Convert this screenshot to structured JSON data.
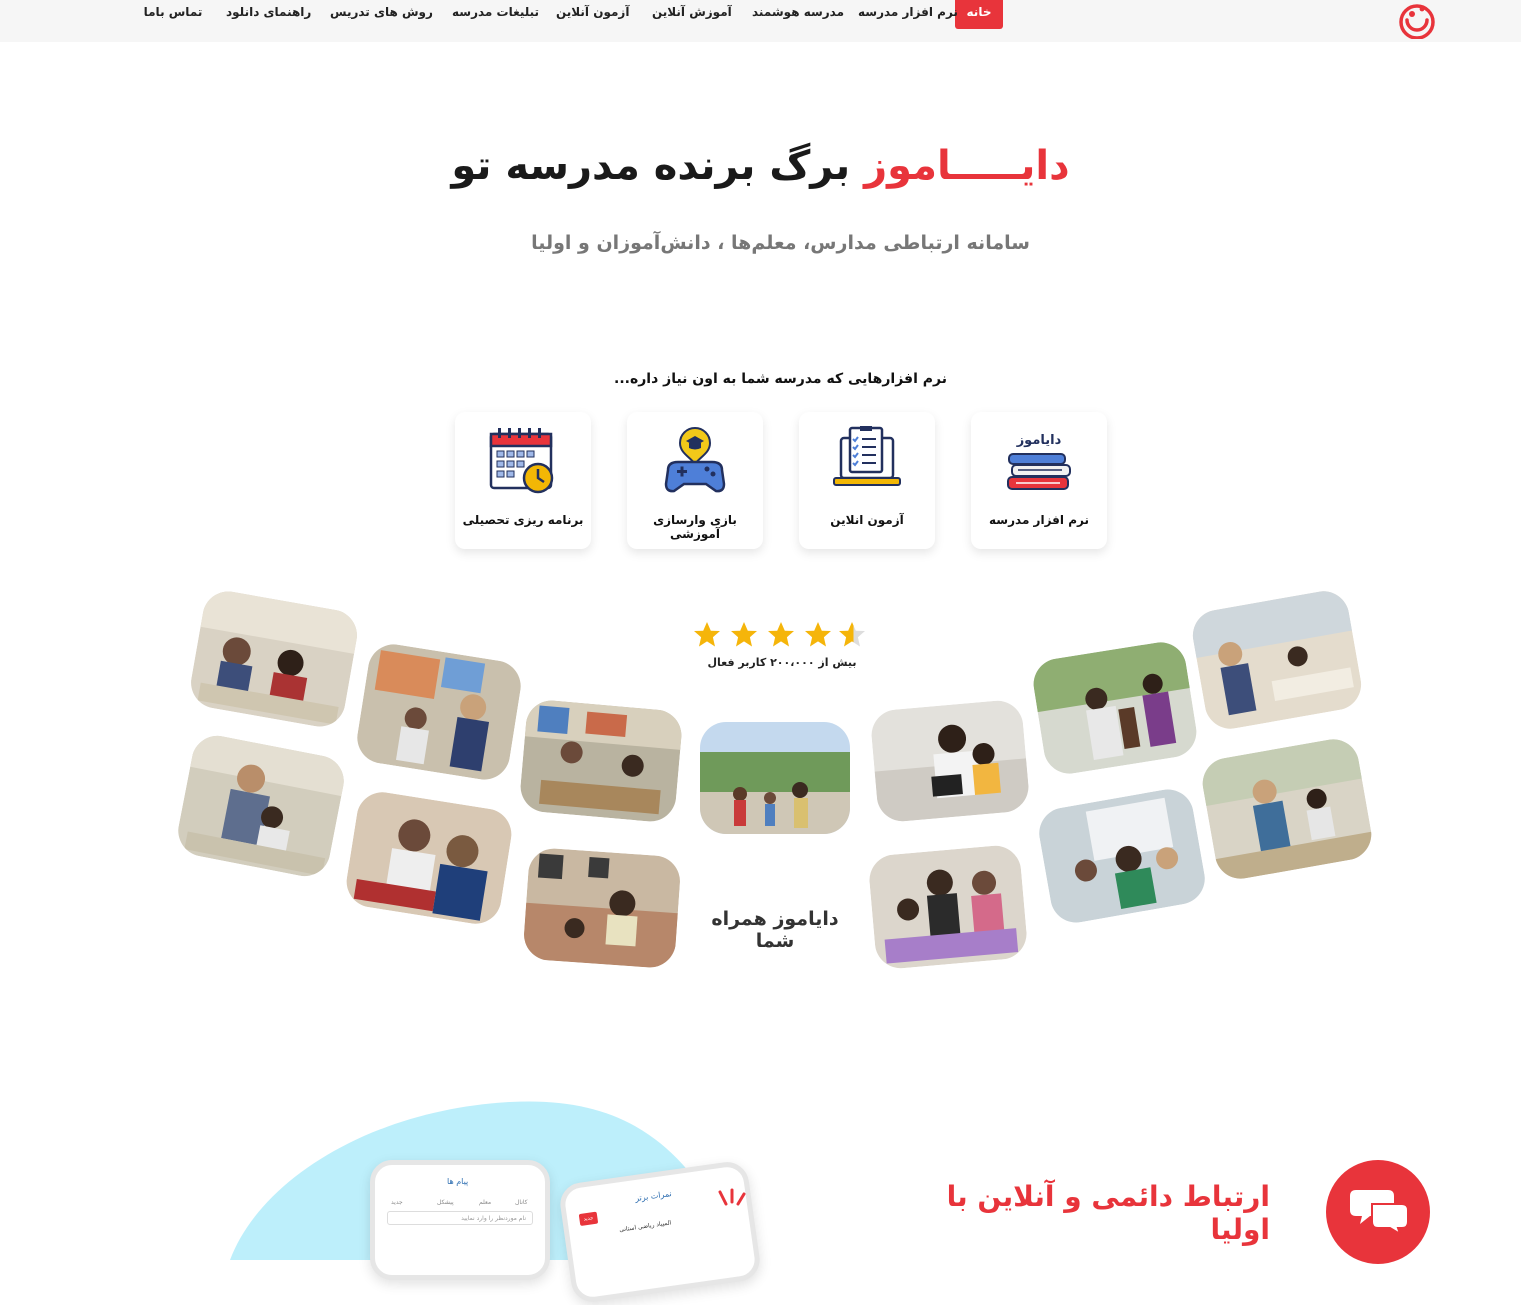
{
  "nav": {
    "items": [
      {
        "label": "خانه",
        "active": true
      },
      {
        "label": "نرم افزار مدرسه"
      },
      {
        "label": "مدرسه هوشمند"
      },
      {
        "label": "آموزش آنلاین"
      },
      {
        "label": "آزمون آنلاین"
      },
      {
        "label": "تبلیغات مدرسه"
      },
      {
        "label": "روش های تدریس"
      },
      {
        "label": "راهنمای دانلود"
      },
      {
        "label": "تماس باما"
      }
    ],
    "logo_icon": "brand-logo-icon"
  },
  "hero": {
    "brand": "دایـــــاموز",
    "title_rest": "برگ برنده مدرسه تو",
    "subtitle": "سامانه ارتباطی مدارس، معلم‌ها ، دانش‌آموزان و اولیا"
  },
  "products": {
    "heading": "نرم افزارهایی که مدرسه شما به اون نیاز داره...",
    "cards": [
      {
        "label": "نرم افزار مدرسه",
        "icon": "books-logo-icon",
        "icon_text": "دایاموز"
      },
      {
        "label": "آزمون انلاین",
        "icon": "laptop-checklist-icon"
      },
      {
        "label": "بازی وارسازی آموزشی",
        "icon": "gamepad-graduation-icon"
      },
      {
        "label": "برنامه ریزی تحصیلی",
        "icon": "calendar-clock-icon"
      }
    ]
  },
  "rating": {
    "stars": 4.5,
    "text": "بیش از ۲۰۰،۰۰۰ کاربر فعال"
  },
  "gallery": {
    "caption": "دایاموز همراه شما"
  },
  "communication": {
    "title": "ارتباط دائمی و آنلاین با اولیا",
    "icon": "chat-bubbles-icon",
    "phone_left": {
      "title": "پیام ها",
      "tabs": [
        "کانال",
        "معلم",
        "پیشکل",
        "جدید"
      ],
      "search_placeholder": "نام موردنظر را وارد نمایید"
    },
    "phone_right": {
      "title": "نمرات برتر",
      "badge": "جدید",
      "item": "المپیاد ریاضی استانی"
    }
  },
  "colors": {
    "accent": "#e8343b",
    "star": "#f5b50a",
    "blob": "#bdeffb"
  }
}
